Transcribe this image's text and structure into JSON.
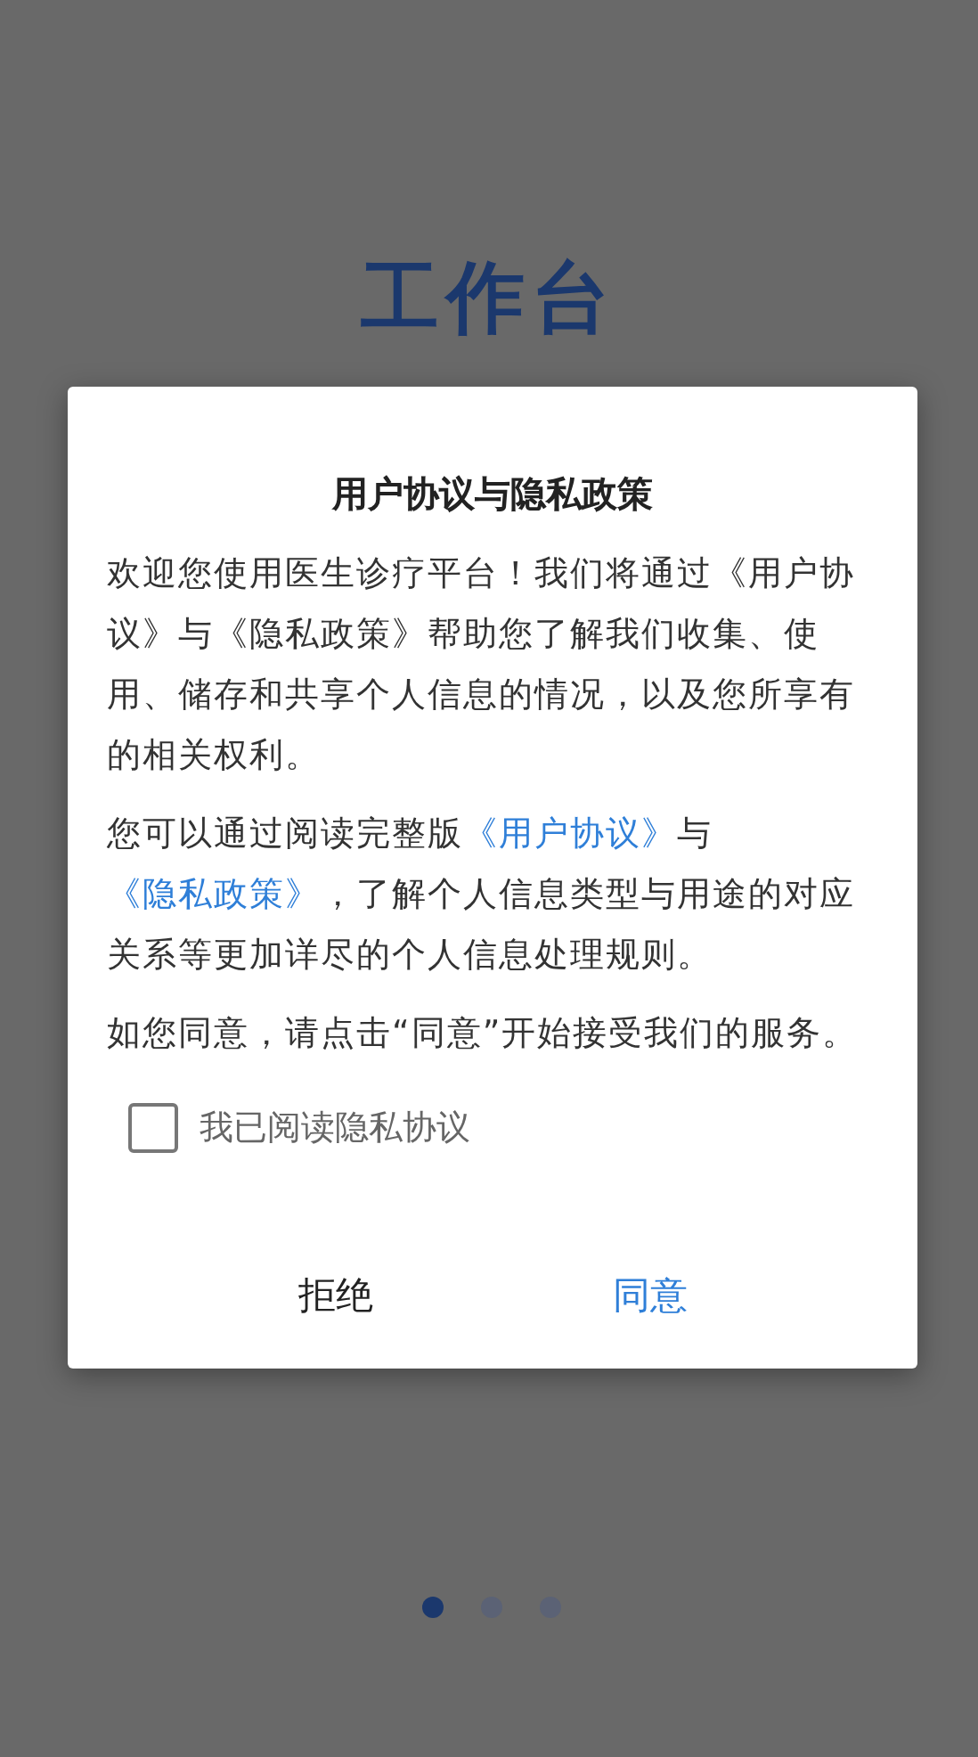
{
  "page": {
    "title": "工作台",
    "dots": [
      {
        "selected": true
      },
      {
        "selected": false
      },
      {
        "selected": false
      }
    ]
  },
  "dialog": {
    "title": "用户协议与隐私政策",
    "paragraphs": [
      [
        {
          "kind": "text",
          "text": "欢迎您使用医生诊疗平台！我们将通过《用户协议》与《隐私政策》帮助您了解我们收集、使用、储存和共享个人信息的情况，以及您所享有的相关权利。"
        }
      ],
      [
        {
          "kind": "text",
          "text": "您可以通过阅读完整版"
        },
        {
          "kind": "link",
          "text": "《用户协议》"
        },
        {
          "kind": "text",
          "text": "与"
        },
        {
          "kind": "link",
          "text": "《隐私政策》"
        },
        {
          "kind": "text",
          "text": "，了解个人信息类型与用途的对应关系等更加详尽的个人信息处理规则。"
        }
      ],
      [
        {
          "kind": "text",
          "text": "如您同意，请点击“同意”开始接受我们的服务。"
        }
      ]
    ],
    "checkbox": {
      "label": "我已阅读隐私协议",
      "checked": false
    },
    "buttons": [
      {
        "label": "拒绝",
        "kind": "secondary"
      },
      {
        "label": "同意",
        "kind": "primary"
      }
    ]
  }
}
